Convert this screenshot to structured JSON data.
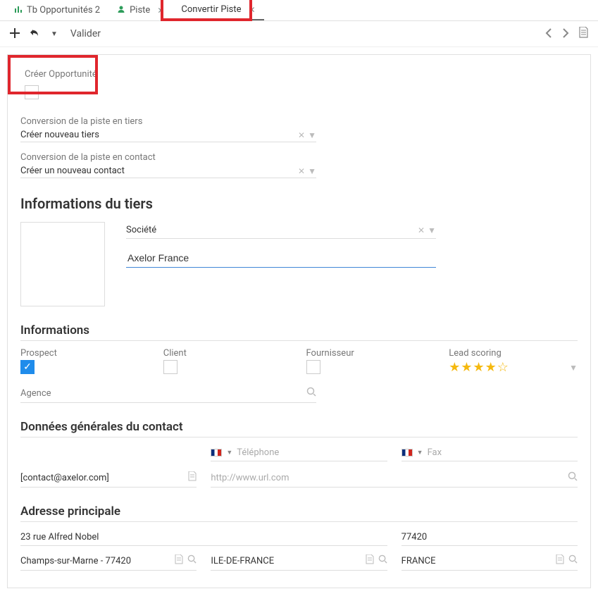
{
  "tabs": [
    {
      "label": "Tb Opportunités 2",
      "icon": "chart"
    },
    {
      "label": "Piste",
      "icon": "user"
    },
    {
      "label": "Convertir Piste",
      "icon": "",
      "active": true
    }
  ],
  "toolbar": {
    "validate": "Valider"
  },
  "opportunity": {
    "label": "Créer Opportunité"
  },
  "conversion_tiers": {
    "label": "Conversion de la piste en tiers",
    "value": "Créer nouveau tiers"
  },
  "conversion_contact": {
    "label": "Conversion de la piste en contact",
    "value": "Créer un nouveau contact"
  },
  "section_tiers": "Informations du tiers",
  "societe": {
    "label": "Société",
    "value": "Axelor France"
  },
  "section_infos": "Informations",
  "prospect": {
    "label": "Prospect"
  },
  "client": {
    "label": "Client"
  },
  "fournisseur": {
    "label": "Fournisseur"
  },
  "lead_scoring": {
    "label": "Lead scoring"
  },
  "agence": {
    "label": "Agence"
  },
  "section_contact": "Données générales du contact",
  "email": {
    "value": "[contact@axelor.com]"
  },
  "telephone": {
    "label": "Téléphone"
  },
  "fax": {
    "label": "Fax"
  },
  "website": {
    "placeholder": "http://www.url.com"
  },
  "section_addr": "Adresse principale",
  "addr_street": "23 rue Alfred Nobel",
  "addr_zip": "77420",
  "addr_city": "Champs-sur-Marne - 77420",
  "addr_region": "ILE-DE-FRANCE",
  "addr_country": "FRANCE"
}
